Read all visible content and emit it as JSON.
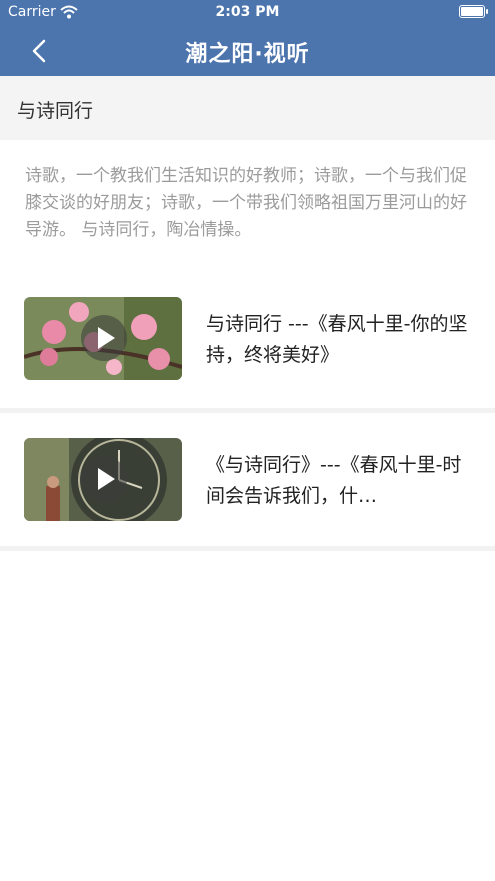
{
  "status_bar": {
    "carrier": "Carrier",
    "time": "2:03 PM"
  },
  "nav": {
    "title": "潮之阳·视听",
    "back_icon": "chevron-left-icon"
  },
  "section": {
    "title": "与诗同行"
  },
  "intro": {
    "text": "诗歌，一个教我们生活知识的好教师；诗歌，一个与我们促膝交谈的好朋友；诗歌，一个带我们领略祖国万里河山的好导游。 与诗同行，陶冶情操。"
  },
  "videos": [
    {
      "title": "与诗同行 ---《春风十里-你的坚持，终将美好》",
      "thumb": "peach-blossom"
    },
    {
      "title": "《与诗同行》---《春风十里-时间会告诉我们，什…",
      "thumb": "clock-tower"
    }
  ],
  "colors": {
    "nav_bg": "#4c74ad",
    "section_bg": "#f4f4f4",
    "intro_text": "#9b9b9b"
  }
}
